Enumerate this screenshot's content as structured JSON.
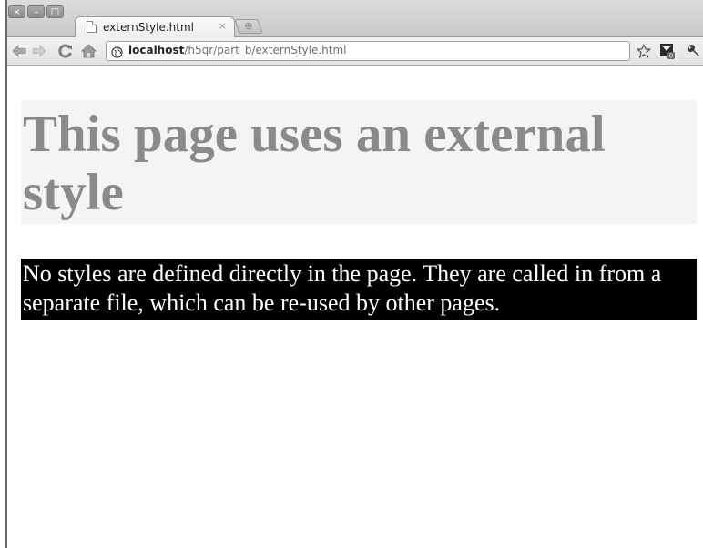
{
  "browser": {
    "window_buttons": [
      "×",
      "–",
      "□"
    ],
    "tab": {
      "title": "externStyle.html",
      "close_glyph": "×"
    },
    "new_tab_glyph": "⊕",
    "address_bar": {
      "host": "localhost",
      "path": "/h5qr/part_b/externStyle.html"
    },
    "toolbar_icons": [
      "back-arrow-icon",
      "forward-arrow-icon",
      "reload-icon",
      "home-icon",
      "globe-icon",
      "star-icon",
      "extension-icon",
      "wrench-icon"
    ]
  },
  "page": {
    "heading": "This page uses an external style",
    "paragraph": "No styles are defined directly in the page. They are called in from a separate file, which can be re-used by other pages."
  },
  "colors": {
    "heading_text": "#8a8a8a",
    "heading_background": "#f4f4f4",
    "paragraph_text": "#ffffff",
    "paragraph_background": "#000000"
  }
}
